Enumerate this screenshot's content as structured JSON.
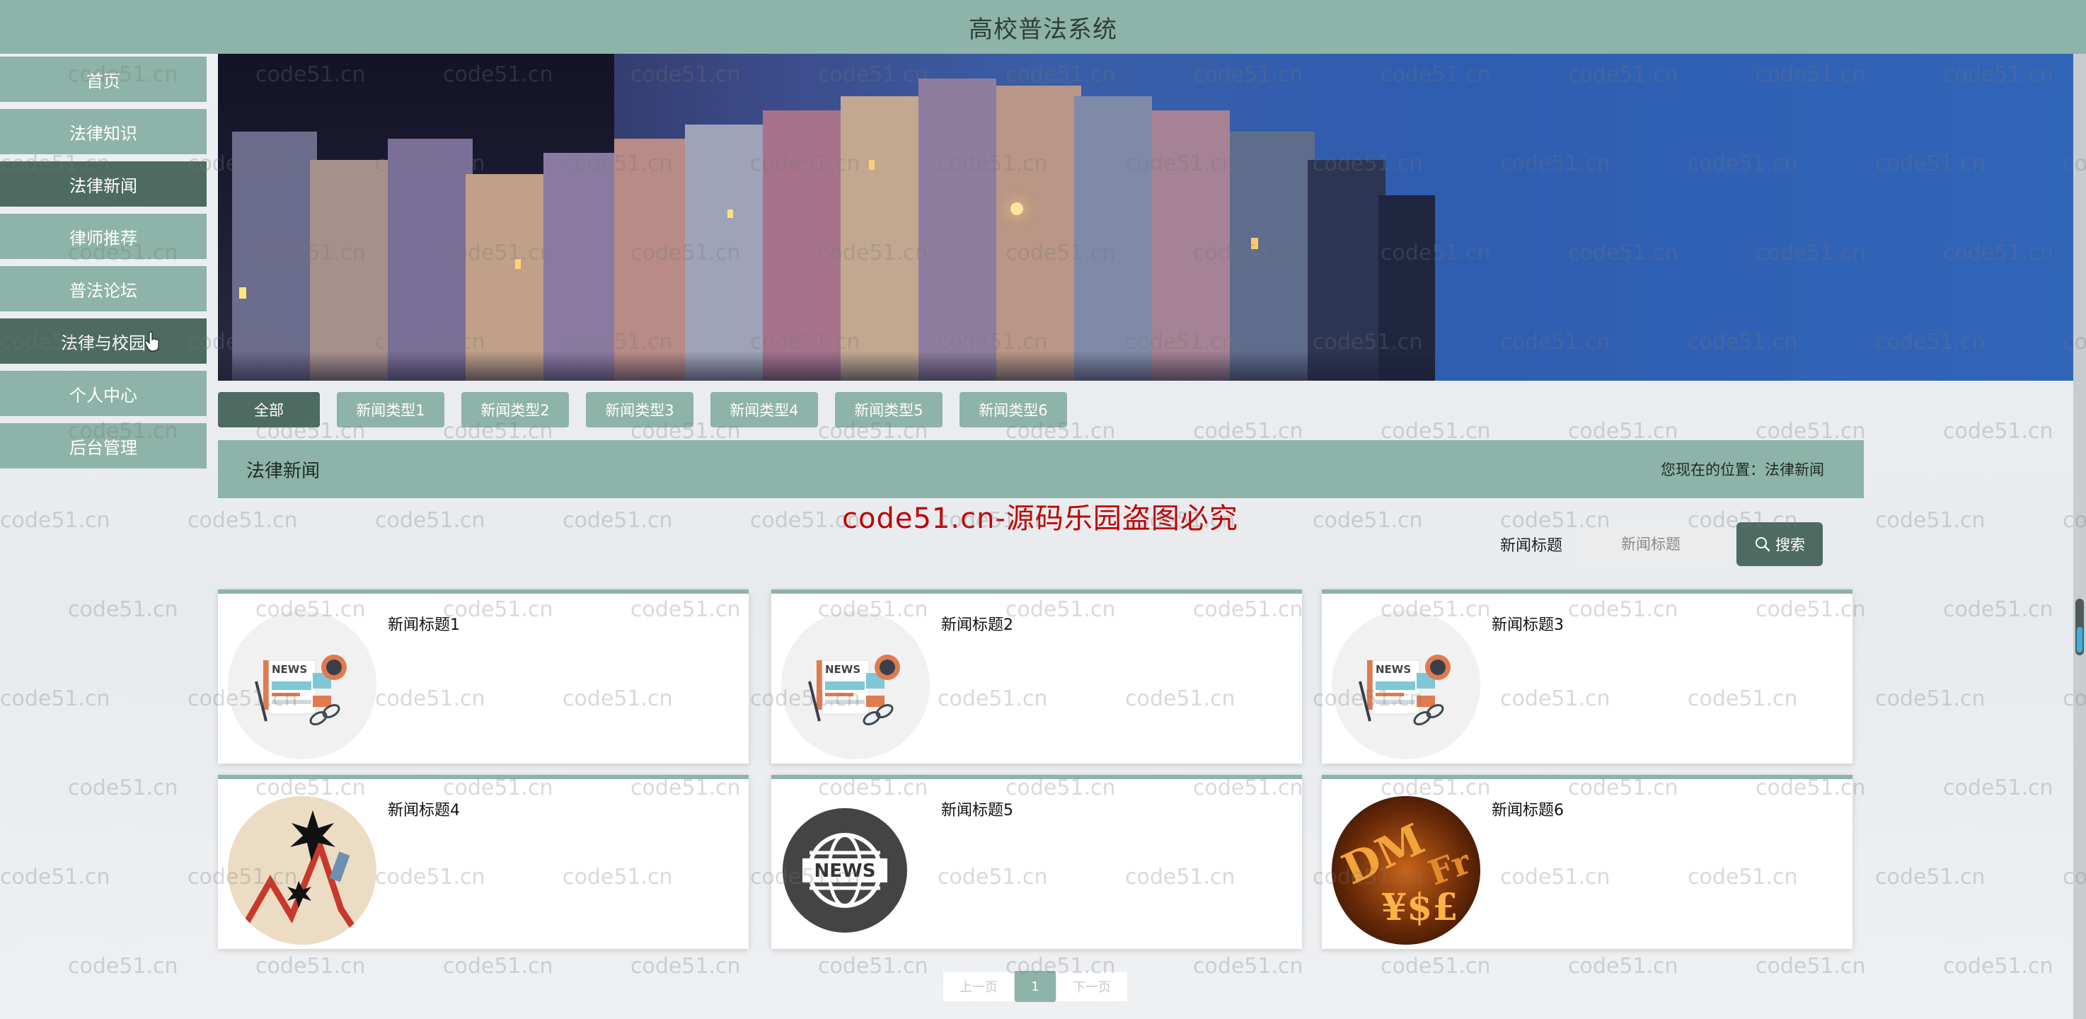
{
  "header": {
    "title": "高校普法系统"
  },
  "sidebar": {
    "items": [
      {
        "label": "首页",
        "active": false
      },
      {
        "label": "法律知识",
        "active": false
      },
      {
        "label": "法律新闻",
        "active": true
      },
      {
        "label": "律师推荐",
        "active": false
      },
      {
        "label": "普法论坛",
        "active": false
      },
      {
        "label": "法律与校园",
        "active": true
      },
      {
        "label": "个人中心",
        "active": false
      },
      {
        "label": "后台管理",
        "active": false
      }
    ]
  },
  "category_tabs": [
    {
      "label": "全部",
      "active": true
    },
    {
      "label": "新闻类型1",
      "active": false
    },
    {
      "label": "新闻类型2",
      "active": false
    },
    {
      "label": "新闻类型3",
      "active": false
    },
    {
      "label": "新闻类型4",
      "active": false
    },
    {
      "label": "新闻类型5",
      "active": false
    },
    {
      "label": "新闻类型6",
      "active": false
    }
  ],
  "section": {
    "title": "法律新闻",
    "breadcrumb": "您现在的位置：法律新闻"
  },
  "copyright_notice": "code51.cn-源码乐园盗图必究",
  "search": {
    "label": "新闻标题",
    "placeholder": "新闻标题",
    "value": "",
    "button_label": "搜索"
  },
  "news": [
    {
      "title": "新闻标题1",
      "image": "newspaper-illustration"
    },
    {
      "title": "新闻标题2",
      "image": "newspaper-illustration"
    },
    {
      "title": "新闻标题3",
      "image": "newspaper-illustration"
    },
    {
      "title": "新闻标题4",
      "image": "chart-crash-illustration"
    },
    {
      "title": "新闻标题5",
      "image": "globe-news-icon"
    },
    {
      "title": "新闻标题6",
      "image": "currency-symbols-photo"
    }
  ],
  "pagination": {
    "prev_label": "上一页",
    "current": "1",
    "next_label": "下一页"
  },
  "watermark": "code51.cn",
  "colors": {
    "primary": "#8eb3a8",
    "active": "#4d6b61",
    "notice": "#c00000"
  }
}
